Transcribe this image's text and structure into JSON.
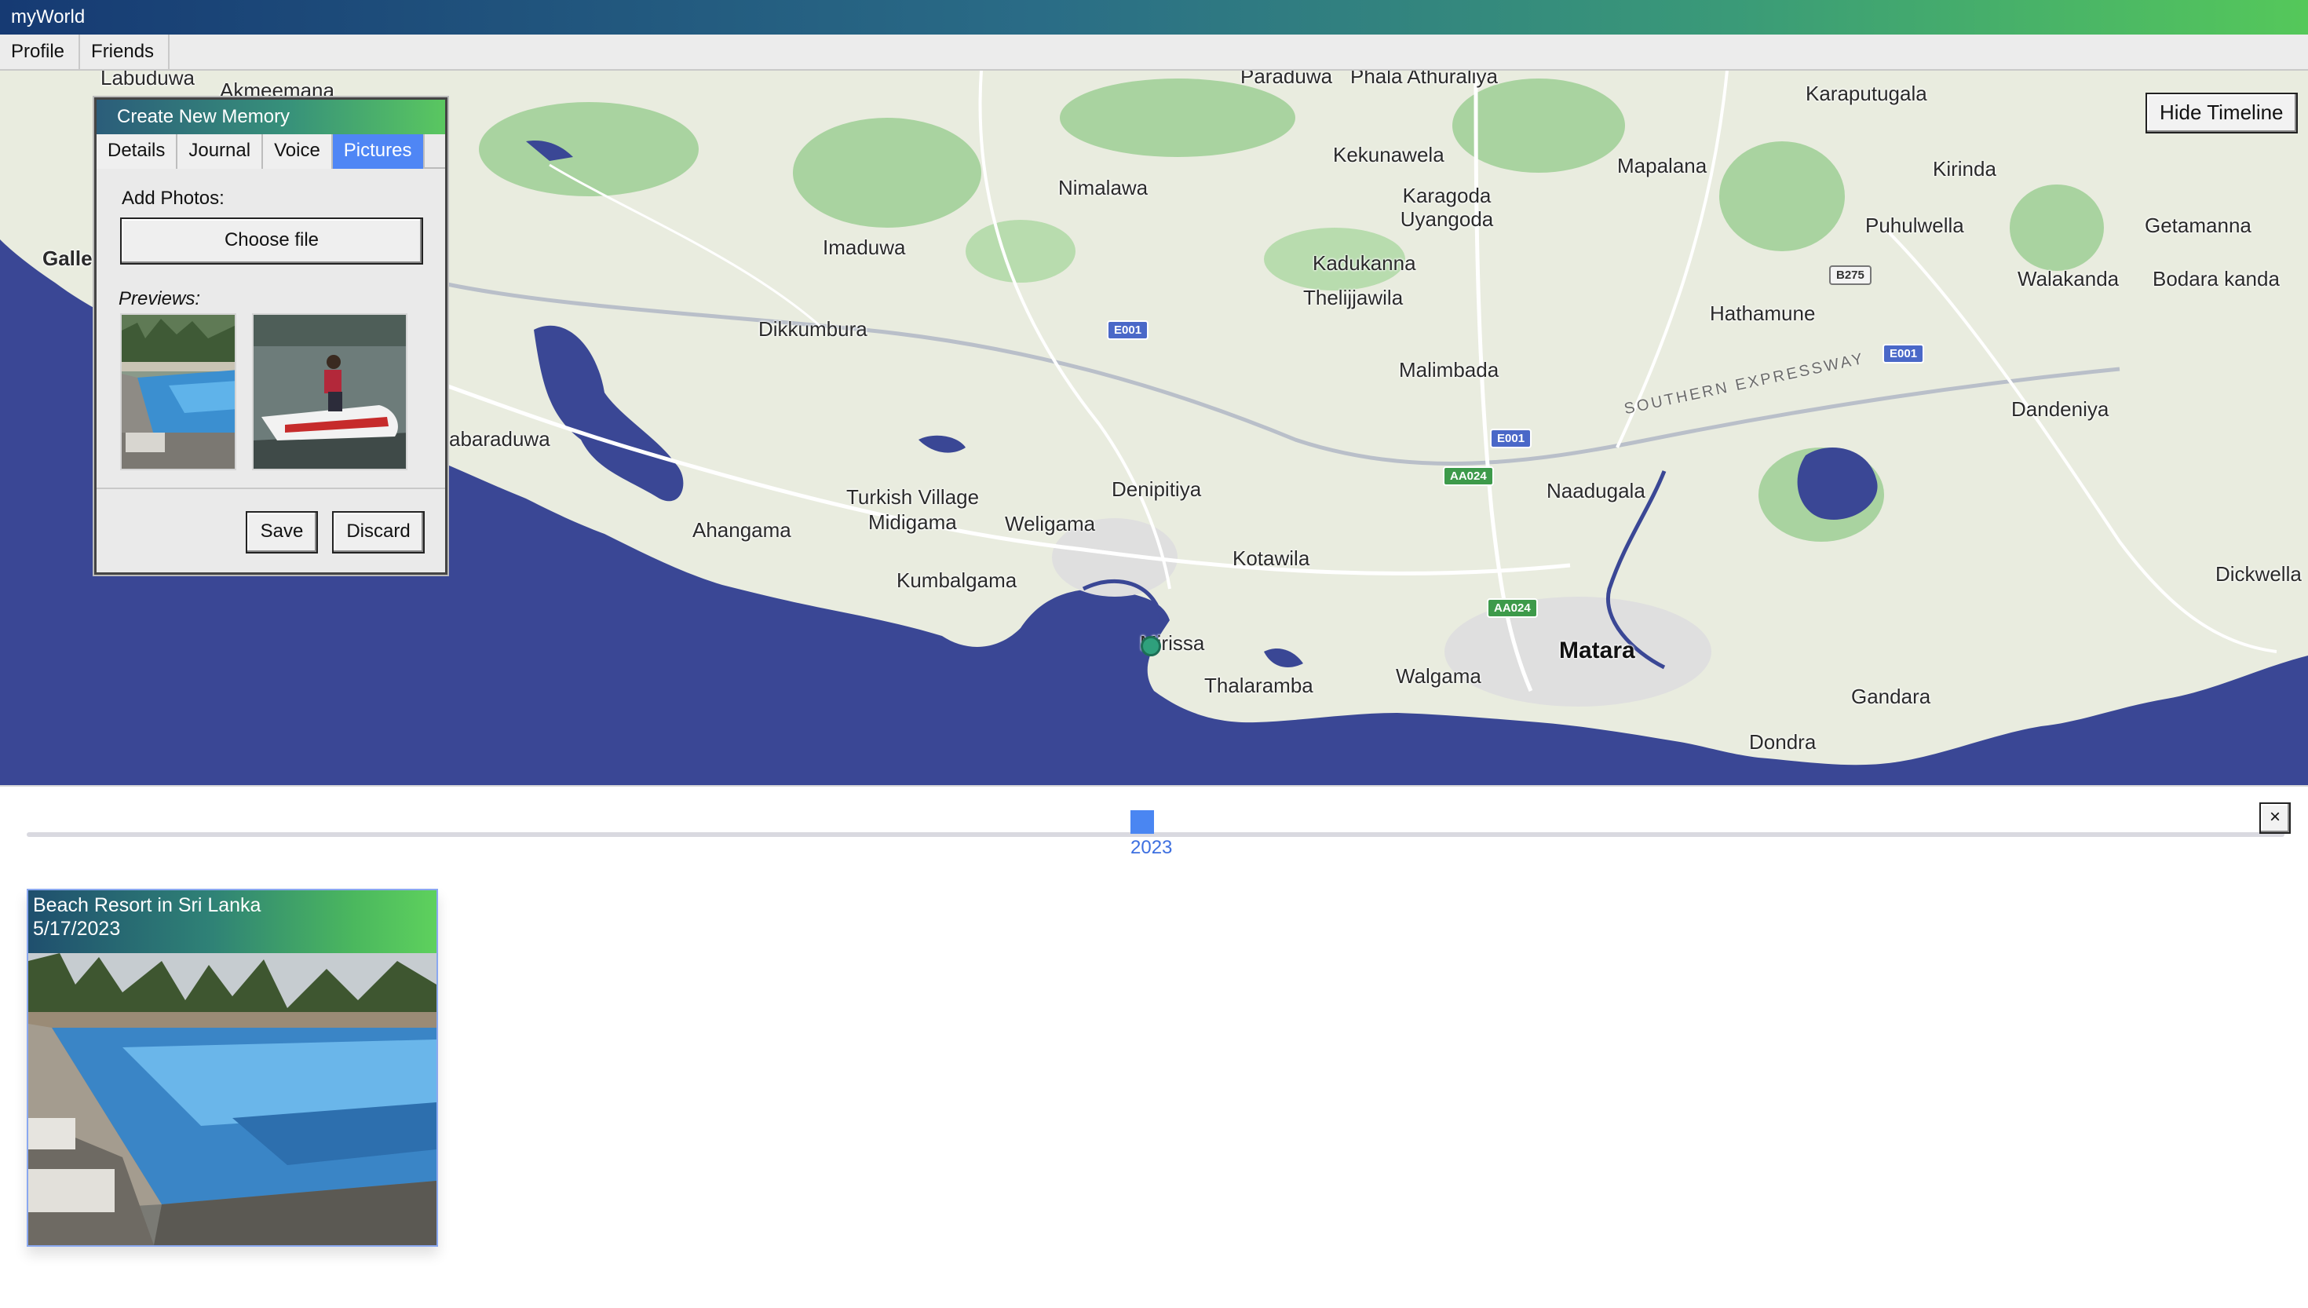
{
  "window": {
    "title": "myWorld"
  },
  "menu": {
    "items": [
      "Profile",
      "Friends"
    ]
  },
  "map": {
    "places": [
      {
        "name": "Labuduwa"
      },
      {
        "name": "Akmeemana"
      },
      {
        "name": "Galle"
      },
      {
        "name": "Paraduwa"
      },
      {
        "name": "Phala Athuraliya"
      },
      {
        "name": "Karaputugala"
      },
      {
        "name": "Kekunawela"
      },
      {
        "name": "Mapalana"
      },
      {
        "name": "Kirinda"
      },
      {
        "name": "Nimalawa"
      },
      {
        "name": "Karagoda Uyangoda"
      },
      {
        "name": "Puhulwella"
      },
      {
        "name": "Getamanna"
      },
      {
        "name": "Imaduwa"
      },
      {
        "name": "Kadukanna"
      },
      {
        "name": "Walakanda"
      },
      {
        "name": "Bodara kanda"
      },
      {
        "name": "Thelijjawila"
      },
      {
        "name": "Hathamune"
      },
      {
        "name": "Dikkumbura"
      },
      {
        "name": "Malimbada"
      },
      {
        "name": "Dandeniya"
      },
      {
        "name": "abaraduwa"
      },
      {
        "name": "Naadugala"
      },
      {
        "name": "Denipitiya"
      },
      {
        "name": "Turkish Village"
      },
      {
        "name": "Midigama"
      },
      {
        "name": "Weligama"
      },
      {
        "name": "Ahangama"
      },
      {
        "name": "Kotawila"
      },
      {
        "name": "Kumbalgama"
      },
      {
        "name": "Dickwella"
      },
      {
        "name": "Mirissa"
      },
      {
        "name": "Matara"
      },
      {
        "name": "Walgama"
      },
      {
        "name": "Thalaramba"
      },
      {
        "name": "Gandara"
      },
      {
        "name": "Dondra"
      }
    ],
    "shields": [
      {
        "label": "E001",
        "color": "blue"
      },
      {
        "label": "E001",
        "color": "blue"
      },
      {
        "label": "E001",
        "color": "blue"
      },
      {
        "label": "AA024",
        "color": "green"
      },
      {
        "label": "AA024",
        "color": "green"
      },
      {
        "label": "B275",
        "color": "white"
      }
    ],
    "road_label": "SOUTHERN EXPRESSWAY",
    "colors": {
      "sea": "#3a4795",
      "land": "#e8ecdf",
      "forest": "#a9d3a0",
      "road": "#ffffff"
    }
  },
  "hide_timeline_label": "Hide Timeline",
  "dialog": {
    "title": "Create New Memory",
    "tabs": [
      "Details",
      "Journal",
      "Voice",
      "Pictures"
    ],
    "active_tab": "Pictures",
    "add_photos_label": "Add Photos:",
    "choose_file_label": "Choose file",
    "previews_label": "Previews:",
    "save_label": "Save",
    "discard_label": "Discard"
  },
  "timeline": {
    "year": "2023",
    "close_label": "×",
    "card": {
      "title": "Beach Resort in Sri Lanka",
      "date": "5/17/2023"
    }
  }
}
